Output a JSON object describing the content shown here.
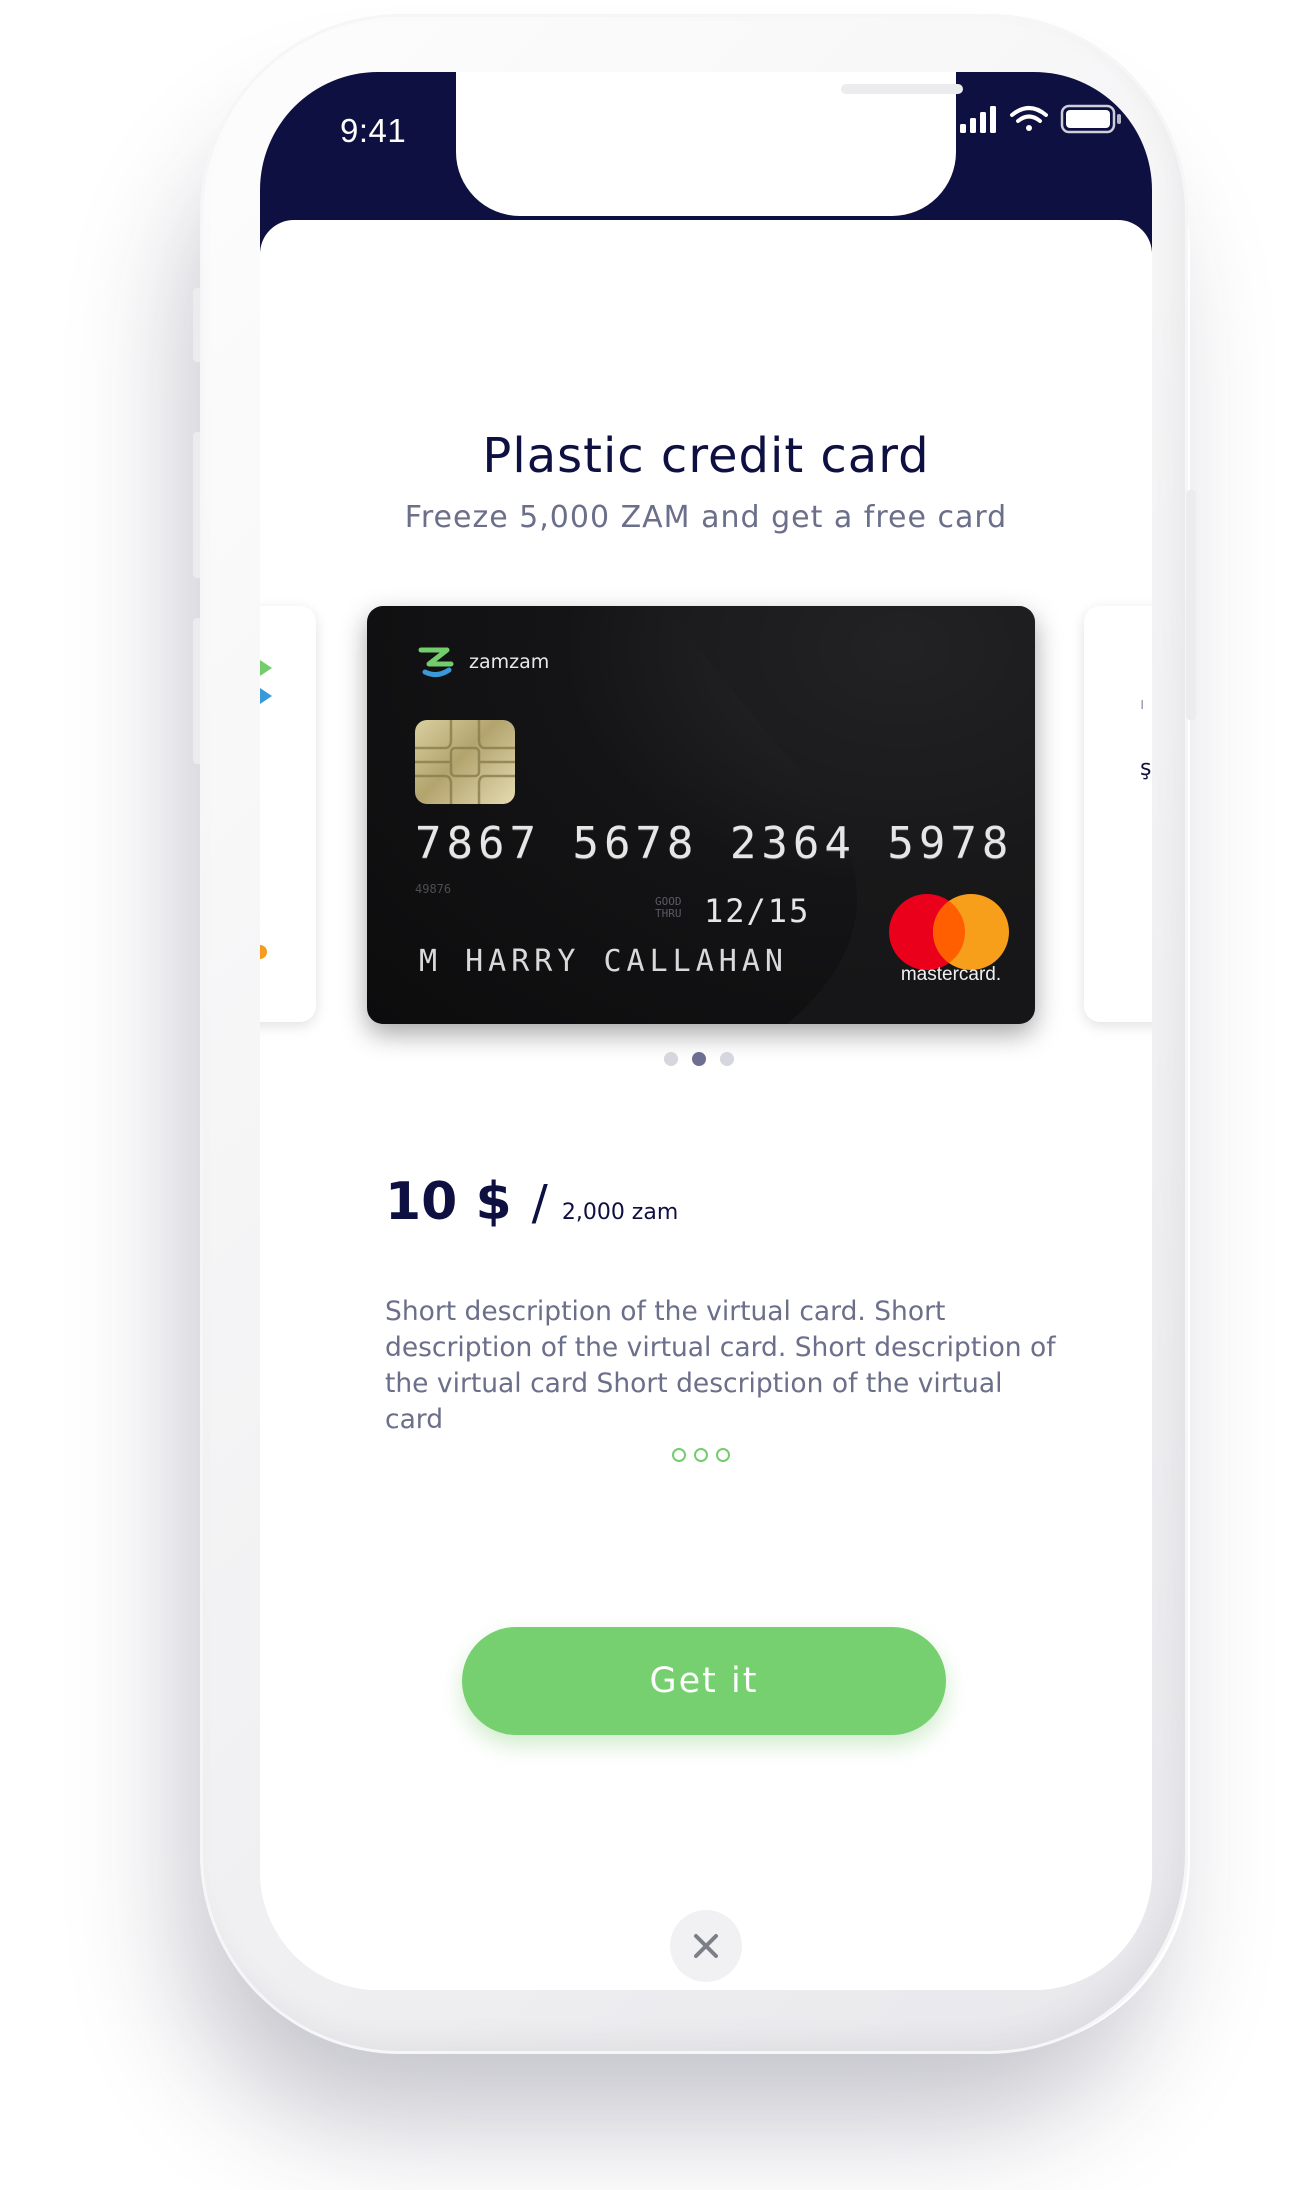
{
  "status_bar": {
    "time": "9:41"
  },
  "offer": {
    "title": "Plastic credit card",
    "subtitle": "Freeze 5,000 ZAM and get a free card"
  },
  "card": {
    "brand": "zamzam",
    "number": "7867 5678 2364 5978",
    "small_number": "49876",
    "good_thru_label": "GOOD THRU",
    "expiry": "12/15",
    "holder": "M HARRY CALLAHAN",
    "network": "mastercard."
  },
  "carousel": {
    "pages": 3,
    "active_index": 1
  },
  "pricing": {
    "price": "10 $",
    "separator": "/",
    "alt_price": "2,000 zam",
    "description": "Short description of the virtual card. Short description of the virtual card. Short description of the virtual card Short description of the virtual card"
  },
  "actions": {
    "primary_label": "Get it",
    "close_icon": "close-icon",
    "more_icon": "more-dots-icon"
  },
  "colors": {
    "header_bg": "#0e1041",
    "accent_green": "#77d070",
    "title_text": "#0e1041",
    "muted_text": "#6b6f8a"
  }
}
